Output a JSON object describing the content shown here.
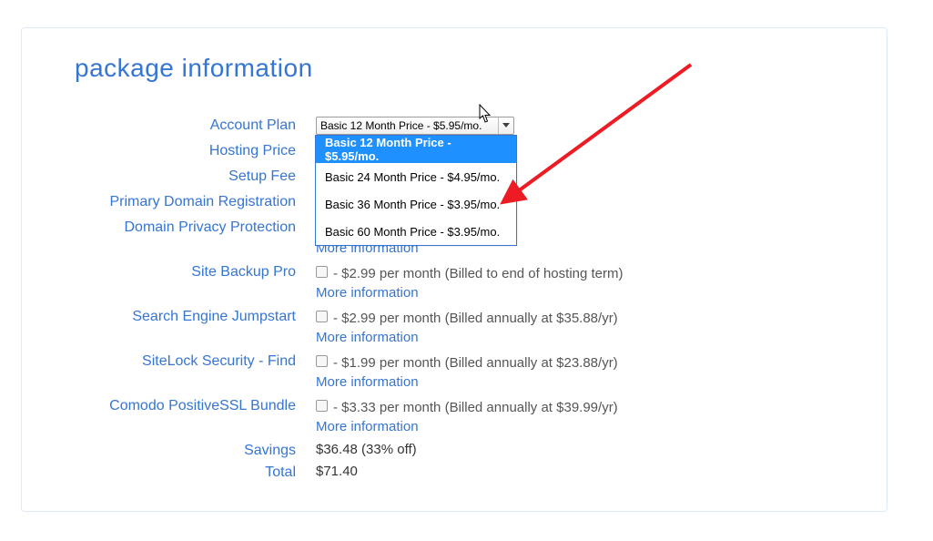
{
  "heading": "package information",
  "labels": {
    "accountPlan": "Account Plan",
    "hostingPrice": "Hosting Price",
    "setupFee": "Setup Fee",
    "primaryDomain": "Primary Domain Registration",
    "domainPrivacy": "Domain Privacy Protection",
    "siteBackup": "Site Backup Pro",
    "searchEngine": "Search Engine Jumpstart",
    "sitelock": "SiteLock Security - Find",
    "comodo": "Comodo PositiveSSL Bundle",
    "savings": "Savings",
    "total": "Total"
  },
  "select": {
    "selectedLabel": "Basic 12 Month Price - $5.95/mo.",
    "options": [
      "Basic 12 Month Price - $5.95/mo.",
      "Basic 24 Month Price - $4.95/mo.",
      "Basic 36 Month Price - $3.95/mo.",
      "Basic 60 Month Price - $3.95/mo."
    ]
  },
  "moreInfo": "More information",
  "addons": {
    "siteBackup": " - $2.99 per month (Billed to end of hosting term)",
    "searchEngine": " - $2.99 per month (Billed annually at $35.88/yr)",
    "sitelock": " - $1.99 per month (Billed annually at $23.88/yr)",
    "comodo": " - $3.33 per month (Billed annually at $39.99/yr)"
  },
  "savingsValue": "$36.48 (33% off)",
  "totalValue": "$71.40"
}
